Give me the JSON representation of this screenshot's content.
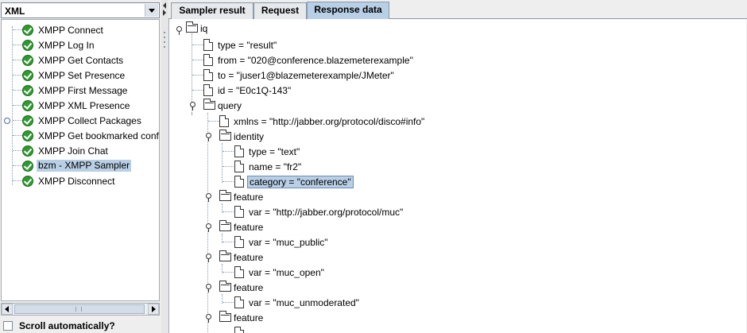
{
  "left_panel": {
    "selector_value": "XML",
    "test_items": [
      {
        "label": "XMPP Connect"
      },
      {
        "label": "XMPP Log In"
      },
      {
        "label": "XMPP Get Contacts"
      },
      {
        "label": "XMPP Set Presence"
      },
      {
        "label": "XMPP First Message"
      },
      {
        "label": "XMPP XML Presence"
      },
      {
        "label": "XMPP Collect Packages"
      },
      {
        "label": "XMPP Get bookmarked confe"
      },
      {
        "label": "XMPP Join Chat"
      },
      {
        "label": "bzm - XMPP Sampler",
        "selected": true
      },
      {
        "label": "XMPP Disconnect"
      }
    ],
    "scroll_auto_label": "Scroll automatically?",
    "scroll_auto_checked": false
  },
  "tabs": [
    {
      "label": "Sampler result"
    },
    {
      "label": "Request"
    },
    {
      "label": "Response data",
      "active": true
    }
  ],
  "response_tree": {
    "root": "iq",
    "attrs_iq": [
      "type = \"result\"",
      "from = \"020@conference.blazemeterexample\"",
      "to = \"juser1@blazemeterexample/JMeter\"",
      "id = \"E0c1Q-143\""
    ],
    "query": "query",
    "xmlns": "xmlns = \"http://jabber.org/protocol/disco#info\"",
    "identity": "identity",
    "identity_attrs": [
      "type = \"text\"",
      "name = \"fr2\"",
      "category = \"conference\""
    ],
    "features": [
      {
        "label": "feature",
        "var": "var = \"http://jabber.org/protocol/muc\""
      },
      {
        "label": "feature",
        "var": "var = \"muc_public\""
      },
      {
        "label": "feature",
        "var": "var = \"muc_open\""
      },
      {
        "label": "feature",
        "var": "var = \"muc_unmoderated\""
      },
      {
        "label": "feature",
        "var": ""
      }
    ]
  },
  "colors": {
    "selection": "#b8cfe5",
    "pass_icon": "#2f9a2f",
    "panel_bg": "#eeeeee"
  }
}
